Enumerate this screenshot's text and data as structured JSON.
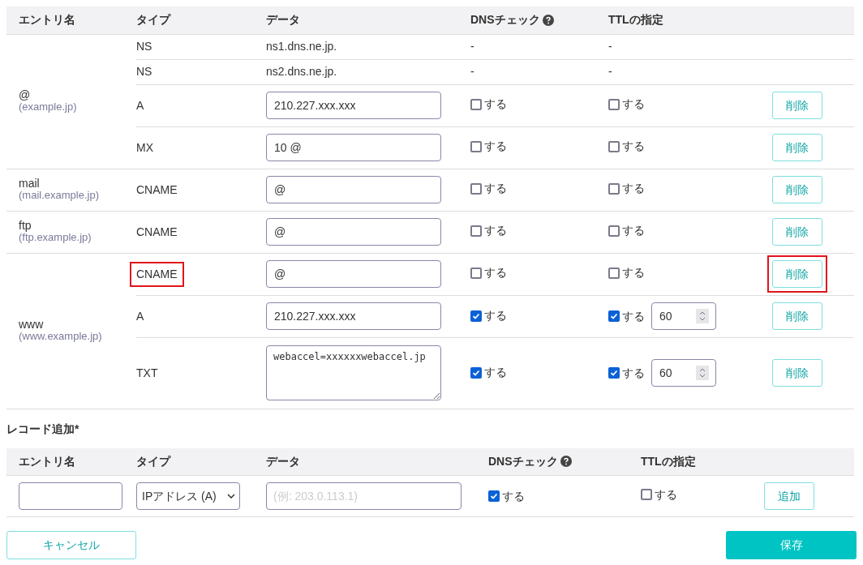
{
  "table": {
    "columns": [
      "エントリ名",
      "タイプ",
      "データ",
      "DNSチェック",
      "TTLの指定"
    ],
    "entries": [
      {
        "name": "@",
        "subname": "(example.jp)",
        "records": [
          {
            "kind": "static",
            "type": "NS",
            "data": "ns1.dns.ne.jp.",
            "dns": "-",
            "ttl": "-",
            "highlighted": false
          },
          {
            "kind": "static",
            "type": "NS",
            "data": "ns2.dns.ne.jp.",
            "dns": "-",
            "ttl": "-",
            "highlighted": false
          },
          {
            "kind": "input",
            "type": "A",
            "data": "210.227.xxx.xxx",
            "dns_label": "する",
            "dns_checked": false,
            "ttl_label": "する",
            "ttl_checked": false,
            "delete": "削除",
            "highlighted": false
          },
          {
            "kind": "input",
            "type": "MX",
            "data": "10 @",
            "dns_label": "する",
            "dns_checked": false,
            "ttl_label": "する",
            "ttl_checked": false,
            "delete": "削除",
            "highlighted": false
          }
        ]
      },
      {
        "name": "mail",
        "subname": "(mail.example.jp)",
        "records": [
          {
            "kind": "input",
            "type": "CNAME",
            "data": "@",
            "dns_label": "する",
            "dns_checked": false,
            "ttl_label": "する",
            "ttl_checked": false,
            "delete": "削除",
            "highlighted": false
          }
        ]
      },
      {
        "name": "ftp",
        "subname": "(ftp.example.jp)",
        "records": [
          {
            "kind": "input",
            "type": "CNAME",
            "data": "@",
            "dns_label": "する",
            "dns_checked": false,
            "ttl_label": "する",
            "ttl_checked": false,
            "delete": "削除",
            "highlighted": false
          }
        ]
      },
      {
        "name": "www",
        "subname": "(www.example.jp)",
        "records": [
          {
            "kind": "input",
            "type": "CNAME",
            "data": "@",
            "dns_label": "する",
            "dns_checked": false,
            "ttl_label": "する",
            "ttl_checked": false,
            "delete": "削除",
            "highlighted": true
          },
          {
            "kind": "input",
            "type": "A",
            "data": "210.227.xxx.xxx",
            "dns_label": "する",
            "dns_checked": true,
            "ttl_label": "する",
            "ttl_checked": true,
            "ttl_value": "60",
            "delete": "削除",
            "highlighted": false
          },
          {
            "kind": "textarea",
            "type": "TXT",
            "data": "webaccel=xxxxxxwebaccel.jp",
            "dns_label": "する",
            "dns_checked": true,
            "ttl_label": "する",
            "ttl_checked": true,
            "ttl_value": "60",
            "delete": "削除",
            "highlighted": false
          }
        ]
      }
    ]
  },
  "add_record": {
    "title": "レコード追加*",
    "columns": [
      "エントリ名",
      "タイプ",
      "データ",
      "DNSチェック",
      "TTLの指定"
    ],
    "type_value": "IPアドレス (A)",
    "data_placeholder": "(例: 203.0.113.1)",
    "dns_label": "する",
    "dns_checked": true,
    "ttl_label": "する",
    "ttl_checked": false,
    "add": "追加"
  },
  "buttons": {
    "cancel": "キャンセル",
    "save": "保存"
  }
}
